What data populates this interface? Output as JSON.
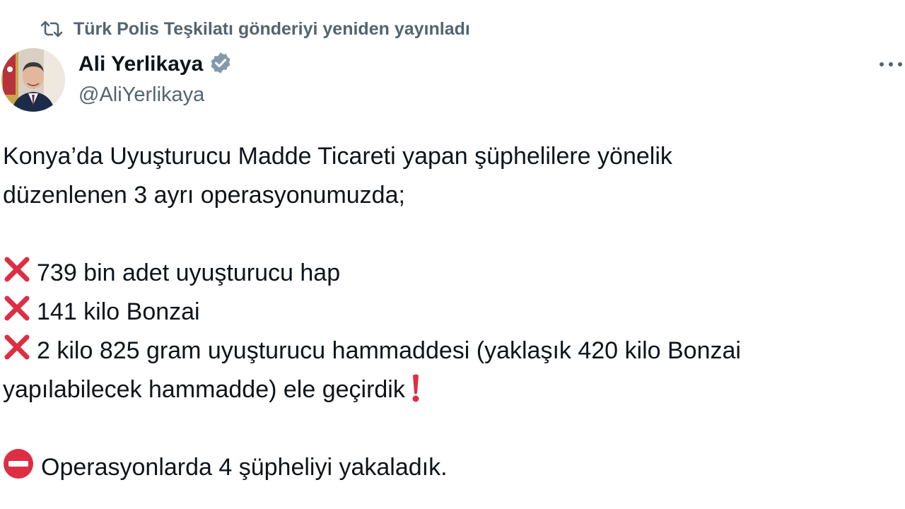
{
  "repost": {
    "icon": "repost-icon",
    "text": "Türk Polis Teşkilatı gönderiyi yeniden yayınladı"
  },
  "author": {
    "display_name": "Ali Yerlikaya",
    "handle": "@AliYerlikaya",
    "verified_icon": "verified-badge-icon",
    "verified_color": "#829aab"
  },
  "more_icon": "more-options-icon",
  "tweet": {
    "intro_line1": "Konya’da Uyuşturucu Madde Ticareti yapan şüphelilere yönelik",
    "intro_line2": "düzenlenen 3 ayrı operasyonumuzda;",
    "items": [
      "739 bin adet uyuşturucu hap",
      "141 kilo Bonzai",
      "2 kilo 825 gram uyuşturucu hammaddesi (yaklaşık 420 kilo Bonzai"
    ],
    "item3_continuation": "yapılabilecek hammadde) ele geçirdik",
    "closing": "Operasyonlarda 4 şüpheliyi yakaladık.",
    "emoji": {
      "cross": "cross-mark-icon",
      "exclamation": "red-exclamation-icon",
      "no_entry": "no-entry-icon"
    },
    "colors": {
      "cross": "#dd2e44",
      "text": "#0f1419",
      "secondary": "#536471"
    }
  }
}
